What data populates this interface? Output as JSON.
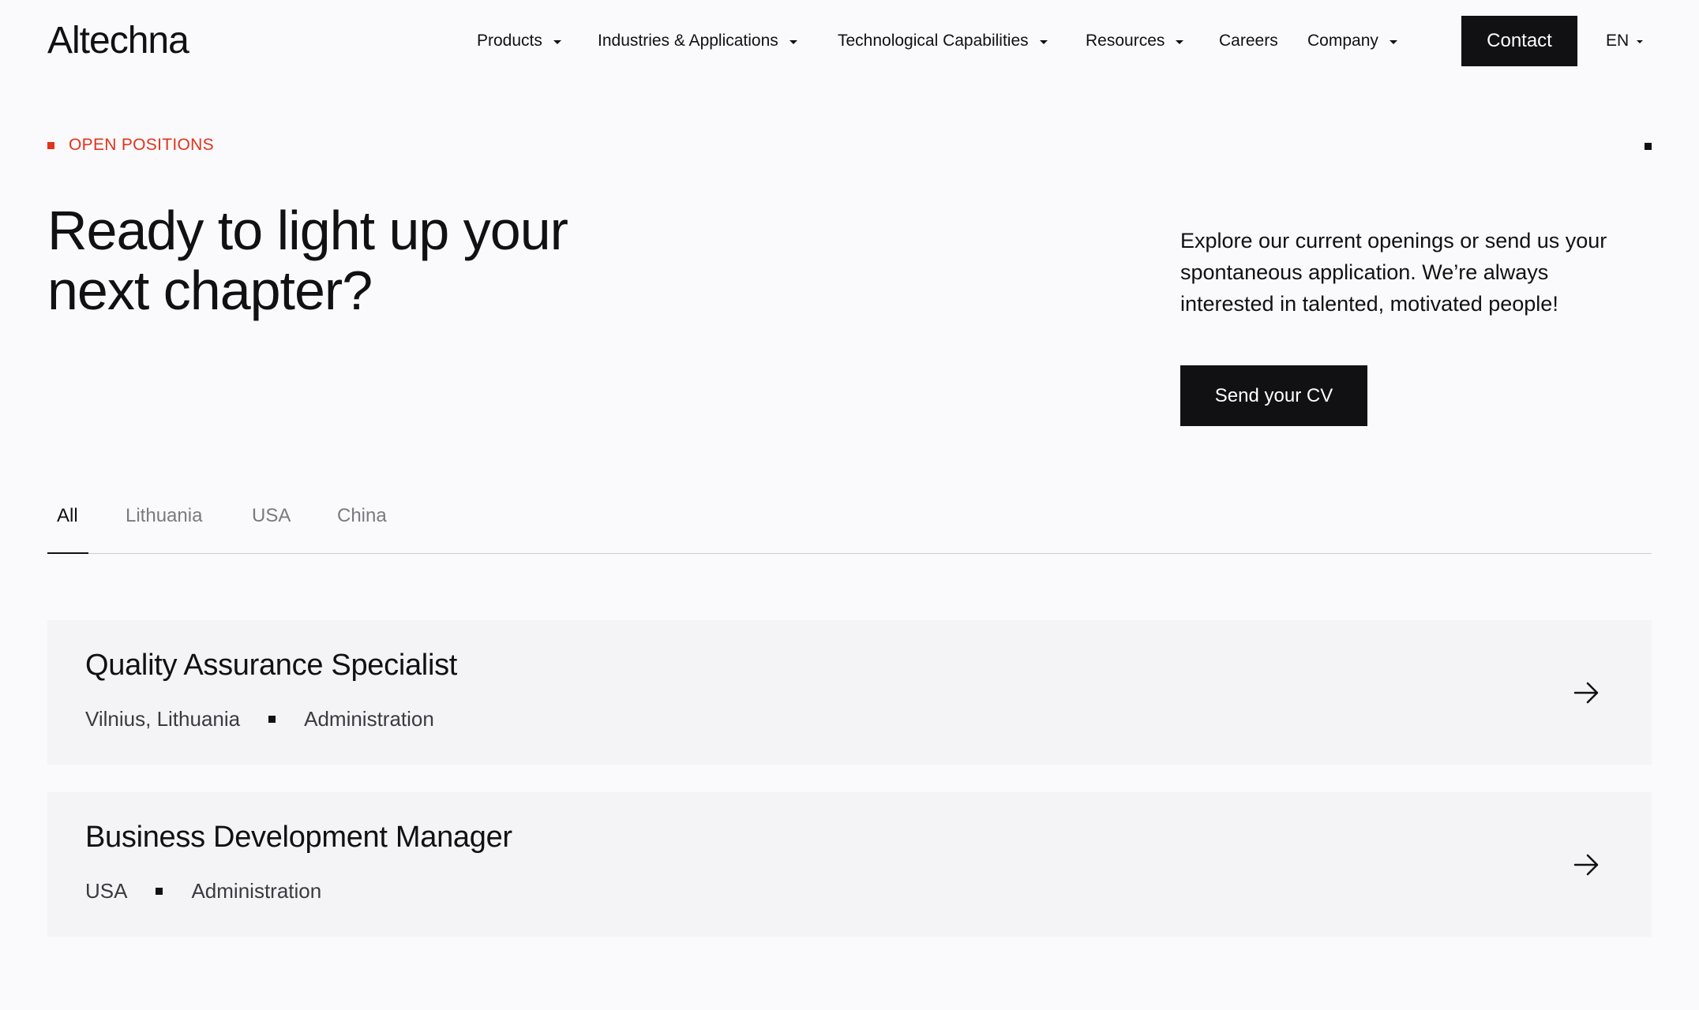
{
  "header": {
    "logo": "Altechna",
    "nav": [
      {
        "label": "Products",
        "dropdown": true
      },
      {
        "label": "Industries & Applications",
        "dropdown": true
      },
      {
        "label": "Technological Capabilities",
        "dropdown": true
      },
      {
        "label": "Resources",
        "dropdown": true
      },
      {
        "label": "Careers",
        "dropdown": false
      },
      {
        "label": "Company",
        "dropdown": true
      }
    ],
    "contact_label": "Contact",
    "language": "EN"
  },
  "hero": {
    "eyebrow": "OPEN POSITIONS",
    "title_line1": "Ready to light up your",
    "title_line2": "next chapter?",
    "description": "Explore our current openings or send us your spontaneous application. We’re always interested in talented, motivated people!",
    "cv_button": "Send your CV"
  },
  "tabs": [
    {
      "label": "All",
      "active": true
    },
    {
      "label": "Lithuania",
      "active": false
    },
    {
      "label": "USA",
      "active": false
    },
    {
      "label": "China",
      "active": false
    }
  ],
  "jobs": [
    {
      "title": "Quality Assurance Specialist",
      "location": "Vilnius, Lithuania",
      "department": "Administration"
    },
    {
      "title": "Business Development Manager",
      "location": "USA",
      "department": "Administration"
    }
  ],
  "colors": {
    "accent": "#e2331b",
    "dark": "#111114",
    "background": "#faf9fb",
    "card": "#f4f3f6"
  },
  "icons": {
    "caret": "chevron-down-icon",
    "job_arrow": "arrow-right-icon"
  }
}
